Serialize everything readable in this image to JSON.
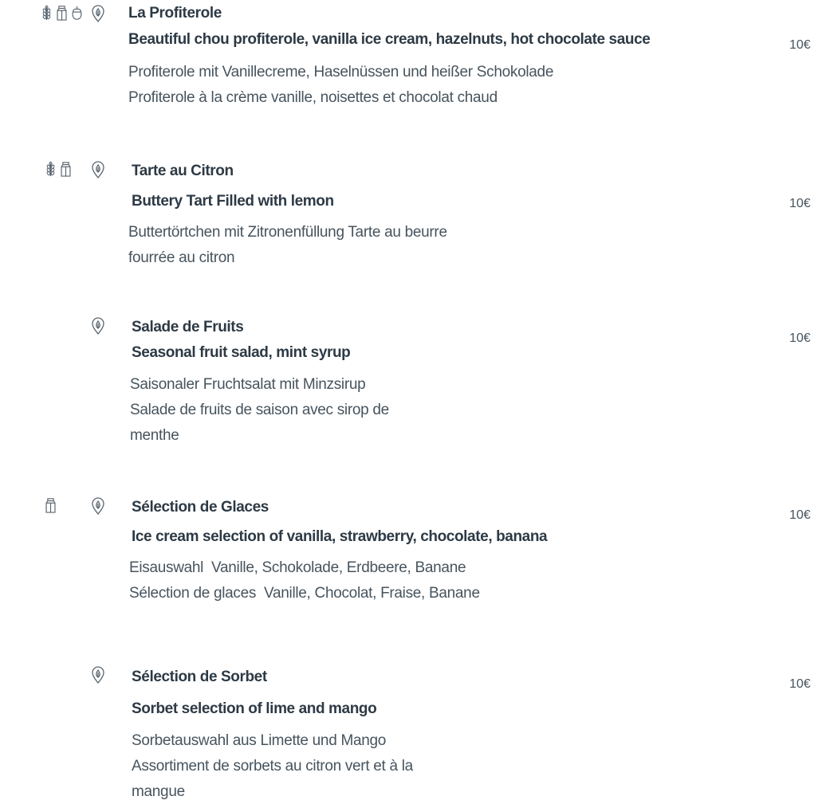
{
  "menu": {
    "currency_note": "",
    "items": [
      {
        "name": "La Profiterole",
        "en": "Beautiful chou profiterole, vanilla ice cream, hazelnuts, hot chocolate sauce",
        "de": "Profiterole mit Vanillecreme, Haselnüssen und heißer Schokolade",
        "fr": "Profiterole à la crème vanille, noisettes et chocolat chaud",
        "price": "10€",
        "allergen_icons": [
          "gluten-icon",
          "milk-icon",
          "nuts-icon"
        ],
        "vegetarian_icon": "vegetarian-icon"
      },
      {
        "name": "Tarte au Citron",
        "en": "Buttery Tart Filled with lemon",
        "de": "Buttertörtchen mit Zitronenfüllung Tarte au beurre",
        "fr": "fourrée au citron",
        "price": "10€",
        "allergen_icons": [
          "gluten-icon",
          "milk-icon"
        ],
        "vegetarian_icon": "vegetarian-icon"
      },
      {
        "name": "Salade de Fruits",
        "en": "Seasonal fruit salad, mint syrup",
        "de": "Saisonaler Fruchtsalat mit Minzsirup",
        "fr": "Salade de fruits de saison avec sirop de",
        "fr2": "menthe",
        "price": "10€",
        "allergen_icons": [],
        "vegetarian_icon": "vegetarian-icon"
      },
      {
        "name": "Sélection de Glaces",
        "en": "Ice cream selection of vanilla, strawberry, chocolate, banana",
        "de": "Eisauswahl  Vanille, Schokolade, Erdbeere, Banane",
        "fr": "Sélection de glaces  Vanille, Chocolat, Fraise, Banane",
        "price": "10€",
        "allergen_icons": [
          "milk-icon"
        ],
        "vegetarian_icon": "vegetarian-icon"
      },
      {
        "name": "Sélection de Sorbet",
        "en": "Sorbet selection of lime and mango",
        "de": "Sorbetauswahl aus Limette und Mango",
        "fr": "Assortiment de sorbets au citron vert et à la",
        "fr2": "mangue",
        "price": "10€",
        "allergen_icons": [],
        "vegetarian_icon": "vegetarian-icon"
      }
    ]
  },
  "colors": {
    "text_dark": "#2d3a45",
    "text_body": "#47545e",
    "icon": "#5a6670"
  }
}
